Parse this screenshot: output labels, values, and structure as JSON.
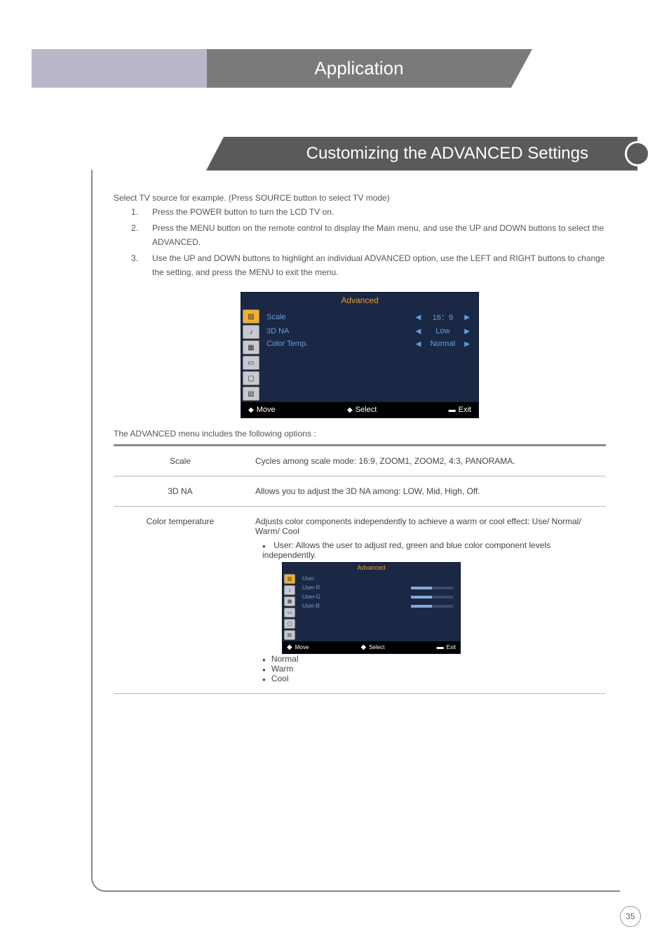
{
  "header": {
    "title": "Application"
  },
  "section": {
    "title": "Customizing the ADVANCED Settings"
  },
  "intro": {
    "lead": "Select TV source for example. (Press SOURCE button to select TV mode)",
    "steps": [
      {
        "num": "1.",
        "text": "Press the POWER button to turn the LCD TV on."
      },
      {
        "num": "2.",
        "text": "Press the MENU button on the remote control to display the Main menu, and use the UP and DOWN buttons to select the ADVANCED."
      },
      {
        "num": "3.",
        "text": "Use the UP and DOWN buttons to highlight an individual ADVANCED option, use the LEFT and RIGHT buttons to change the setting, and press the MENU to exit the menu."
      }
    ]
  },
  "osd_main": {
    "title": "Advanced",
    "rows": [
      {
        "label": "Scale",
        "value": "16：9"
      },
      {
        "label": "3D NA",
        "value": "Low"
      },
      {
        "label": "Color Temp.",
        "value": "Normal"
      }
    ],
    "footer": {
      "move": "Move",
      "select": "Select",
      "exit": "Exit"
    }
  },
  "sub_heading": "The ADVANCED menu includes the following options :",
  "options": [
    {
      "name": "Scale",
      "desc": "Cycles among scale mode: 16:9, ZOOM1, ZOOM2, 4:3, PANORAMA."
    },
    {
      "name": "3D NA",
      "desc": "Allows you to adjust the 3D NA among: LOW, Mid, High, Off."
    }
  ],
  "color_temp": {
    "name": "Color temperature",
    "desc": "Adjusts color components independently to achieve a warm or cool effect: Use/ Normal/ Warm/ Cool",
    "user_desc": "User: Allows the user to adjust red, green and blue color component levels independently.",
    "osd": {
      "title": "Advanced",
      "rows": [
        {
          "label": "User"
        },
        {
          "label": "User-R",
          "fill": 50
        },
        {
          "label": "User-G",
          "fill": 50
        },
        {
          "label": "User-B",
          "fill": 50
        }
      ],
      "footer": {
        "move": "Move",
        "select": "Select",
        "exit": "Exit"
      }
    },
    "extras": [
      "Normal",
      "Warm",
      "Cool"
    ]
  },
  "page_number": "35"
}
